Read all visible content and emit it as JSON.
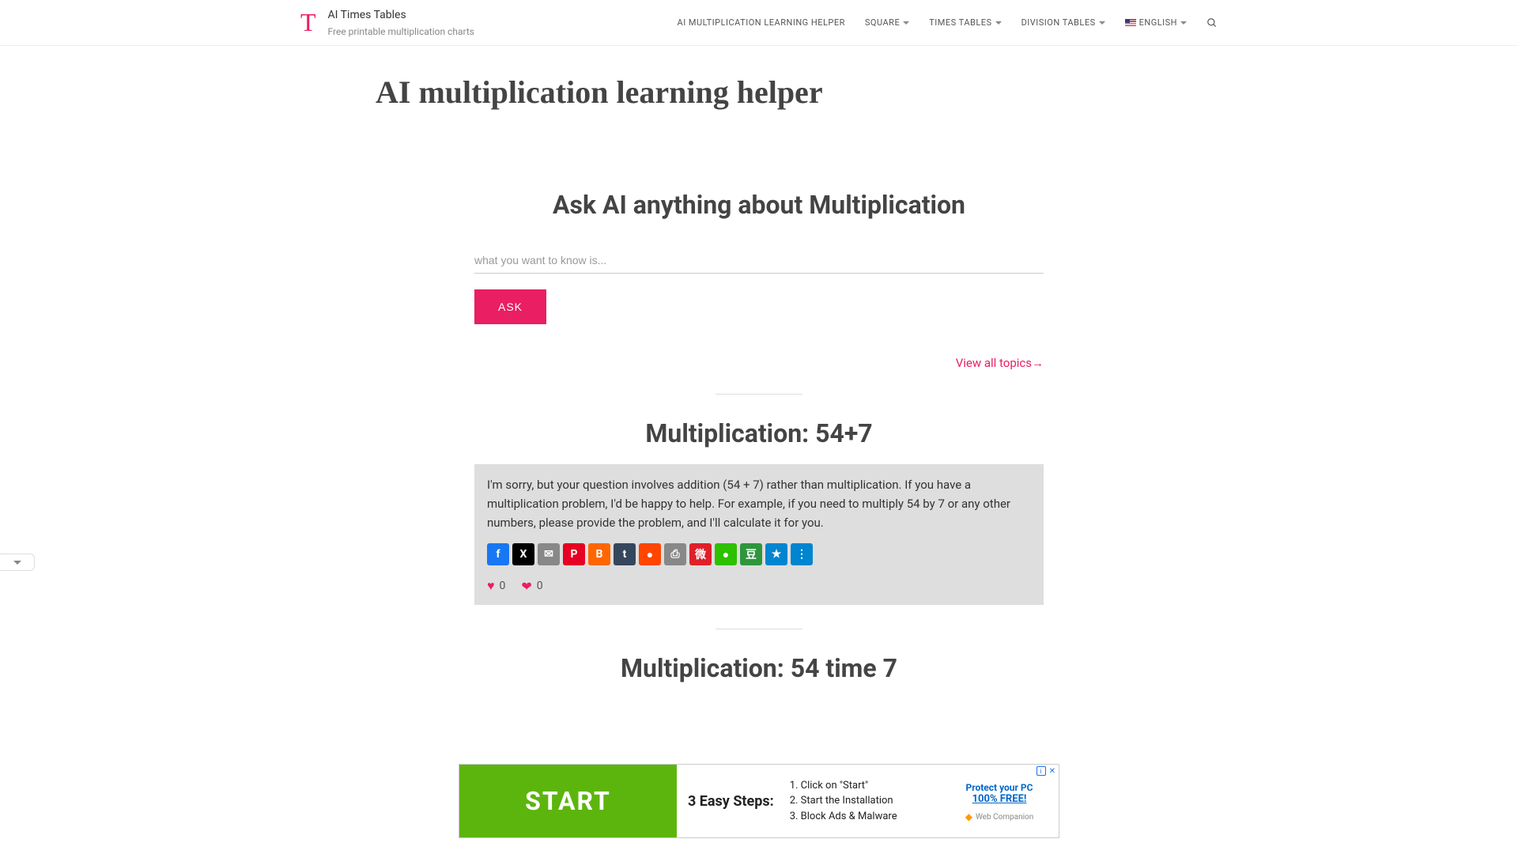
{
  "header": {
    "logo_letter": "T",
    "site_title": "AI Times Tables",
    "tagline": "Free printable multiplication charts",
    "nav": {
      "helper": "AI MULTIPLICATION LEARNING HELPER",
      "square": "SQUARE",
      "times": "TIMES TABLES",
      "division": "DIVISION TABLES",
      "english": "ENGLISH"
    }
  },
  "page": {
    "title": "AI multiplication learning helper",
    "ask_heading": "Ask AI anything about Multiplication",
    "input_placeholder": "what you want to know is...",
    "ask_button": "ASK",
    "view_all": "View all topics→"
  },
  "topic1": {
    "title": "Multiplication: 54+7",
    "answer": "I'm sorry, but your question involves addition (54 + 7) rather than multiplication. If you have a multiplication problem, I'd be happy to help. For example, if you need to multiply 54 by 7 or any other numbers, please provide the problem, and I'll calculate it for you.",
    "like_count": "0",
    "love_count": "0"
  },
  "topic2": {
    "title": "Multiplication: 54 time 7"
  },
  "share": {
    "fb": "f",
    "x": "X",
    "email": "✉",
    "pin": "P",
    "blog": "B",
    "tumblr": "t",
    "reddit": "●",
    "print": "⎙",
    "weibo": "微",
    "wechat": "●",
    "douban": "豆",
    "qzone": "★",
    "share": "⋮"
  },
  "ad": {
    "start": "START",
    "steps_title": "3 Easy Steps:",
    "step1": "1. Click on \"Start\"",
    "step2": "2. Start the Installation",
    "step3": "3. Block Ads & Malware",
    "protect": "Protect your PC",
    "free": "100% FREE!",
    "brand": "Web Companion",
    "close": "✕",
    "info": "i"
  }
}
